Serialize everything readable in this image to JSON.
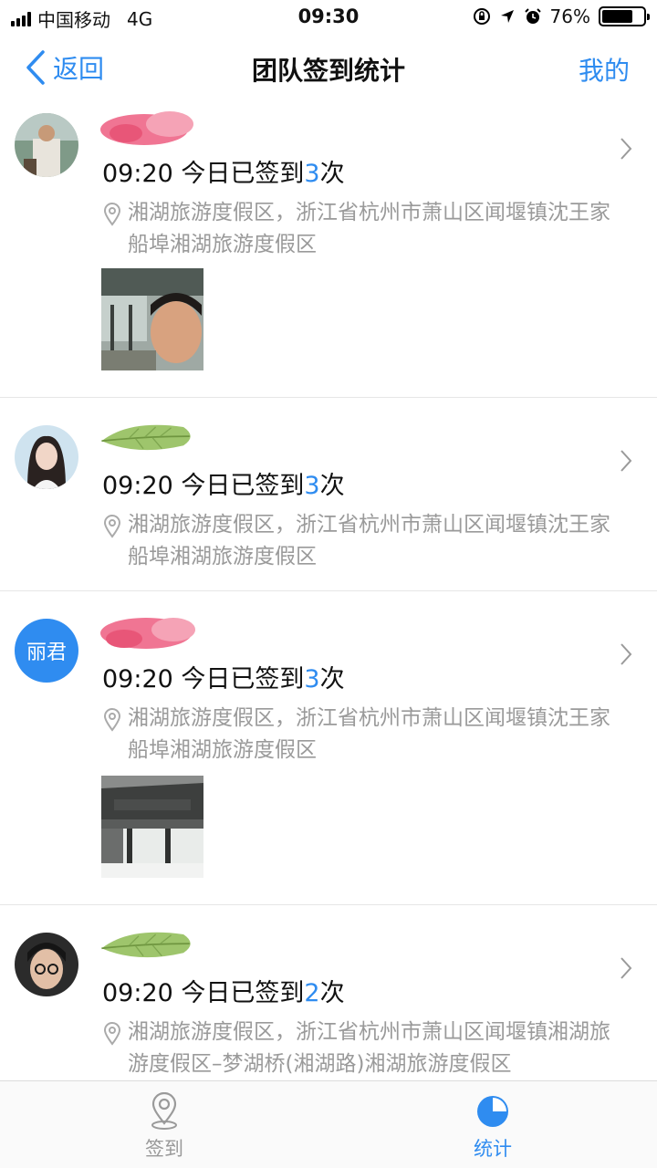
{
  "status_bar": {
    "carrier": "中国移动",
    "network": "4G",
    "time": "09:30",
    "battery_percent": "76%",
    "battery_level": 0.76
  },
  "nav": {
    "back_label": "返回",
    "title": "团队签到统计",
    "mine_label": "我的"
  },
  "checkin_prefix": "今日已签到",
  "checkin_suffix": "次",
  "records": [
    {
      "time": "09:20",
      "count": "3",
      "address": "湘湖旅游度假区，浙江省杭州市萧山区闻堰镇沈王家船埠湘湖旅游度假区"
    },
    {
      "time": "09:20",
      "count": "3",
      "address": "湘湖旅游度假区，浙江省杭州市萧山区闻堰镇沈王家船埠湘湖旅游度假区"
    },
    {
      "avatar_text": "丽君",
      "time": "09:20",
      "count": "3",
      "address": "湘湖旅游度假区，浙江省杭州市萧山区闻堰镇沈王家船埠湘湖旅游度假区"
    },
    {
      "time": "09:20",
      "count": "2",
      "address": "湘湖旅游度假区，浙江省杭州市萧山区闻堰镇湘湖旅游度假区–梦湖桥(湘湖路)湘湖旅游度假区"
    }
  ],
  "tabs": [
    {
      "label": "签到",
      "active": false,
      "icon": "location-pin-icon"
    },
    {
      "label": "统计",
      "active": true,
      "icon": "pie-chart-icon"
    }
  ],
  "colors": {
    "accent": "#2f8cf0",
    "secondary_text": "#9a9a9a",
    "divider": "#e6e6e6"
  }
}
